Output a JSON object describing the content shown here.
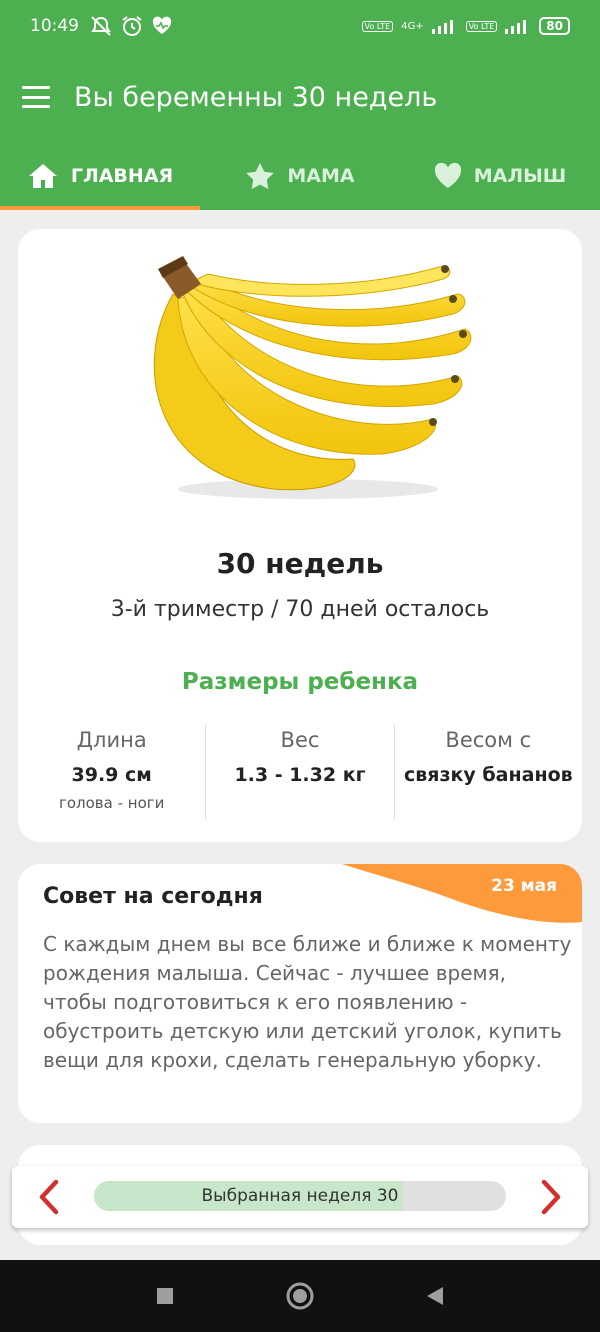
{
  "status_bar": {
    "time": "10:49",
    "network": "4G+",
    "volte_label": "Vo LTE",
    "battery": "80"
  },
  "app_bar": {
    "title": "Вы беременны 30 недель",
    "menu_icon": "hamburger-icon"
  },
  "tabs": [
    {
      "label": "ГЛАВНАЯ",
      "icon": "home-icon",
      "active": true
    },
    {
      "label": "МАМА",
      "icon": "star-icon",
      "active": false
    },
    {
      "label": "МАЛЫШ",
      "icon": "heart-icon",
      "active": false
    }
  ],
  "main_card": {
    "image": "banana-bunch",
    "weeks": "30 недель",
    "trimester": "3-й триместр / 70 дней осталось",
    "sizes_title": "Размеры ребенка",
    "stats": [
      {
        "label": "Длина",
        "value": "39.9 см",
        "sub": "голова - ноги"
      },
      {
        "label": "Вес",
        "value": "1.3 - 1.32 кг",
        "sub": ""
      },
      {
        "label": "Весом с",
        "value": "связку бананов",
        "sub": ""
      }
    ]
  },
  "tip_card": {
    "title": "Совет на сегодня",
    "date": "23 мая",
    "text": "С каждым днем вы все ближе и ближе к моменту рождения малыша. Сейчас - лучшее время, чтобы подготовиться к его появлению - обустроить детскую или детский уголок, купить вещи для крохи, сделать генеральную уборку."
  },
  "week_selector": {
    "label": "Выбранная неделя 30",
    "progress_fraction": 0.75
  },
  "colors": {
    "primary": "#4caf50",
    "accent": "#ff9a3c",
    "arrow": "#d32f2f"
  }
}
